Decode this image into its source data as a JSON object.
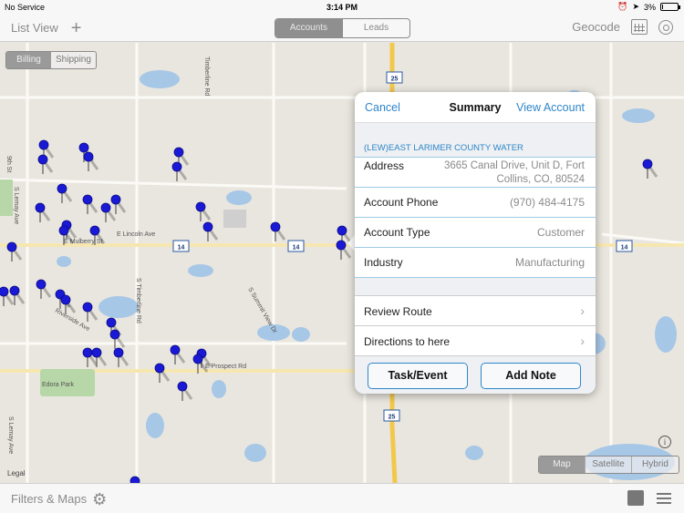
{
  "status": {
    "carrier": "No Service",
    "time": "3:14 PM",
    "battery": "3%"
  },
  "nav": {
    "list_view": "List View",
    "tabs": [
      {
        "label": "Accounts",
        "active": true
      },
      {
        "label": "Leads",
        "active": false
      }
    ],
    "geocode": "Geocode"
  },
  "map": {
    "address_toggle": [
      {
        "label": "Billing",
        "active": true
      },
      {
        "label": "Shipping",
        "active": false
      }
    ],
    "map_types": [
      {
        "label": "Map",
        "active": true
      },
      {
        "label": "Satellite",
        "active": false
      },
      {
        "label": "Hybrid",
        "active": false
      }
    ],
    "legal": "Legal",
    "info_symbol": "i",
    "highway_shields": [
      "14",
      "14",
      "14",
      "25",
      "25"
    ],
    "road_labels": [
      "E Mulberry St",
      "E Lincoln Ave",
      "E Prospect Rd",
      "S Timberline Rd",
      "S Summit View Dr",
      "Riverside Ave",
      "S Lemay Ave",
      "Edora Park",
      "Timberline Rd",
      "9th St"
    ]
  },
  "popover": {
    "cancel": "Cancel",
    "title": "Summary",
    "view_account": "View Account",
    "account_name": "(LEW)EAST LARIMER COUNTY WATER",
    "fields": [
      {
        "label": "Address",
        "value": "3665 Canal Drive, Unit D, Fort Collins, CO, 80524"
      },
      {
        "label": "Account Phone",
        "value": "(970) 484-4175"
      },
      {
        "label": "Account Type",
        "value": "Customer"
      },
      {
        "label": "Industry",
        "value": "Manufacturing"
      }
    ],
    "actions": [
      "Review Route",
      "Directions to here"
    ],
    "buttons": [
      "Task/Event",
      "Add Note"
    ]
  },
  "bottom": {
    "filters": "Filters & Maps"
  },
  "colors": {
    "accent": "#2e86c9",
    "pin": "#1a1ad6",
    "water": "#a7c7e6",
    "park": "#b7d7a8",
    "highway": "#f2c84b"
  }
}
